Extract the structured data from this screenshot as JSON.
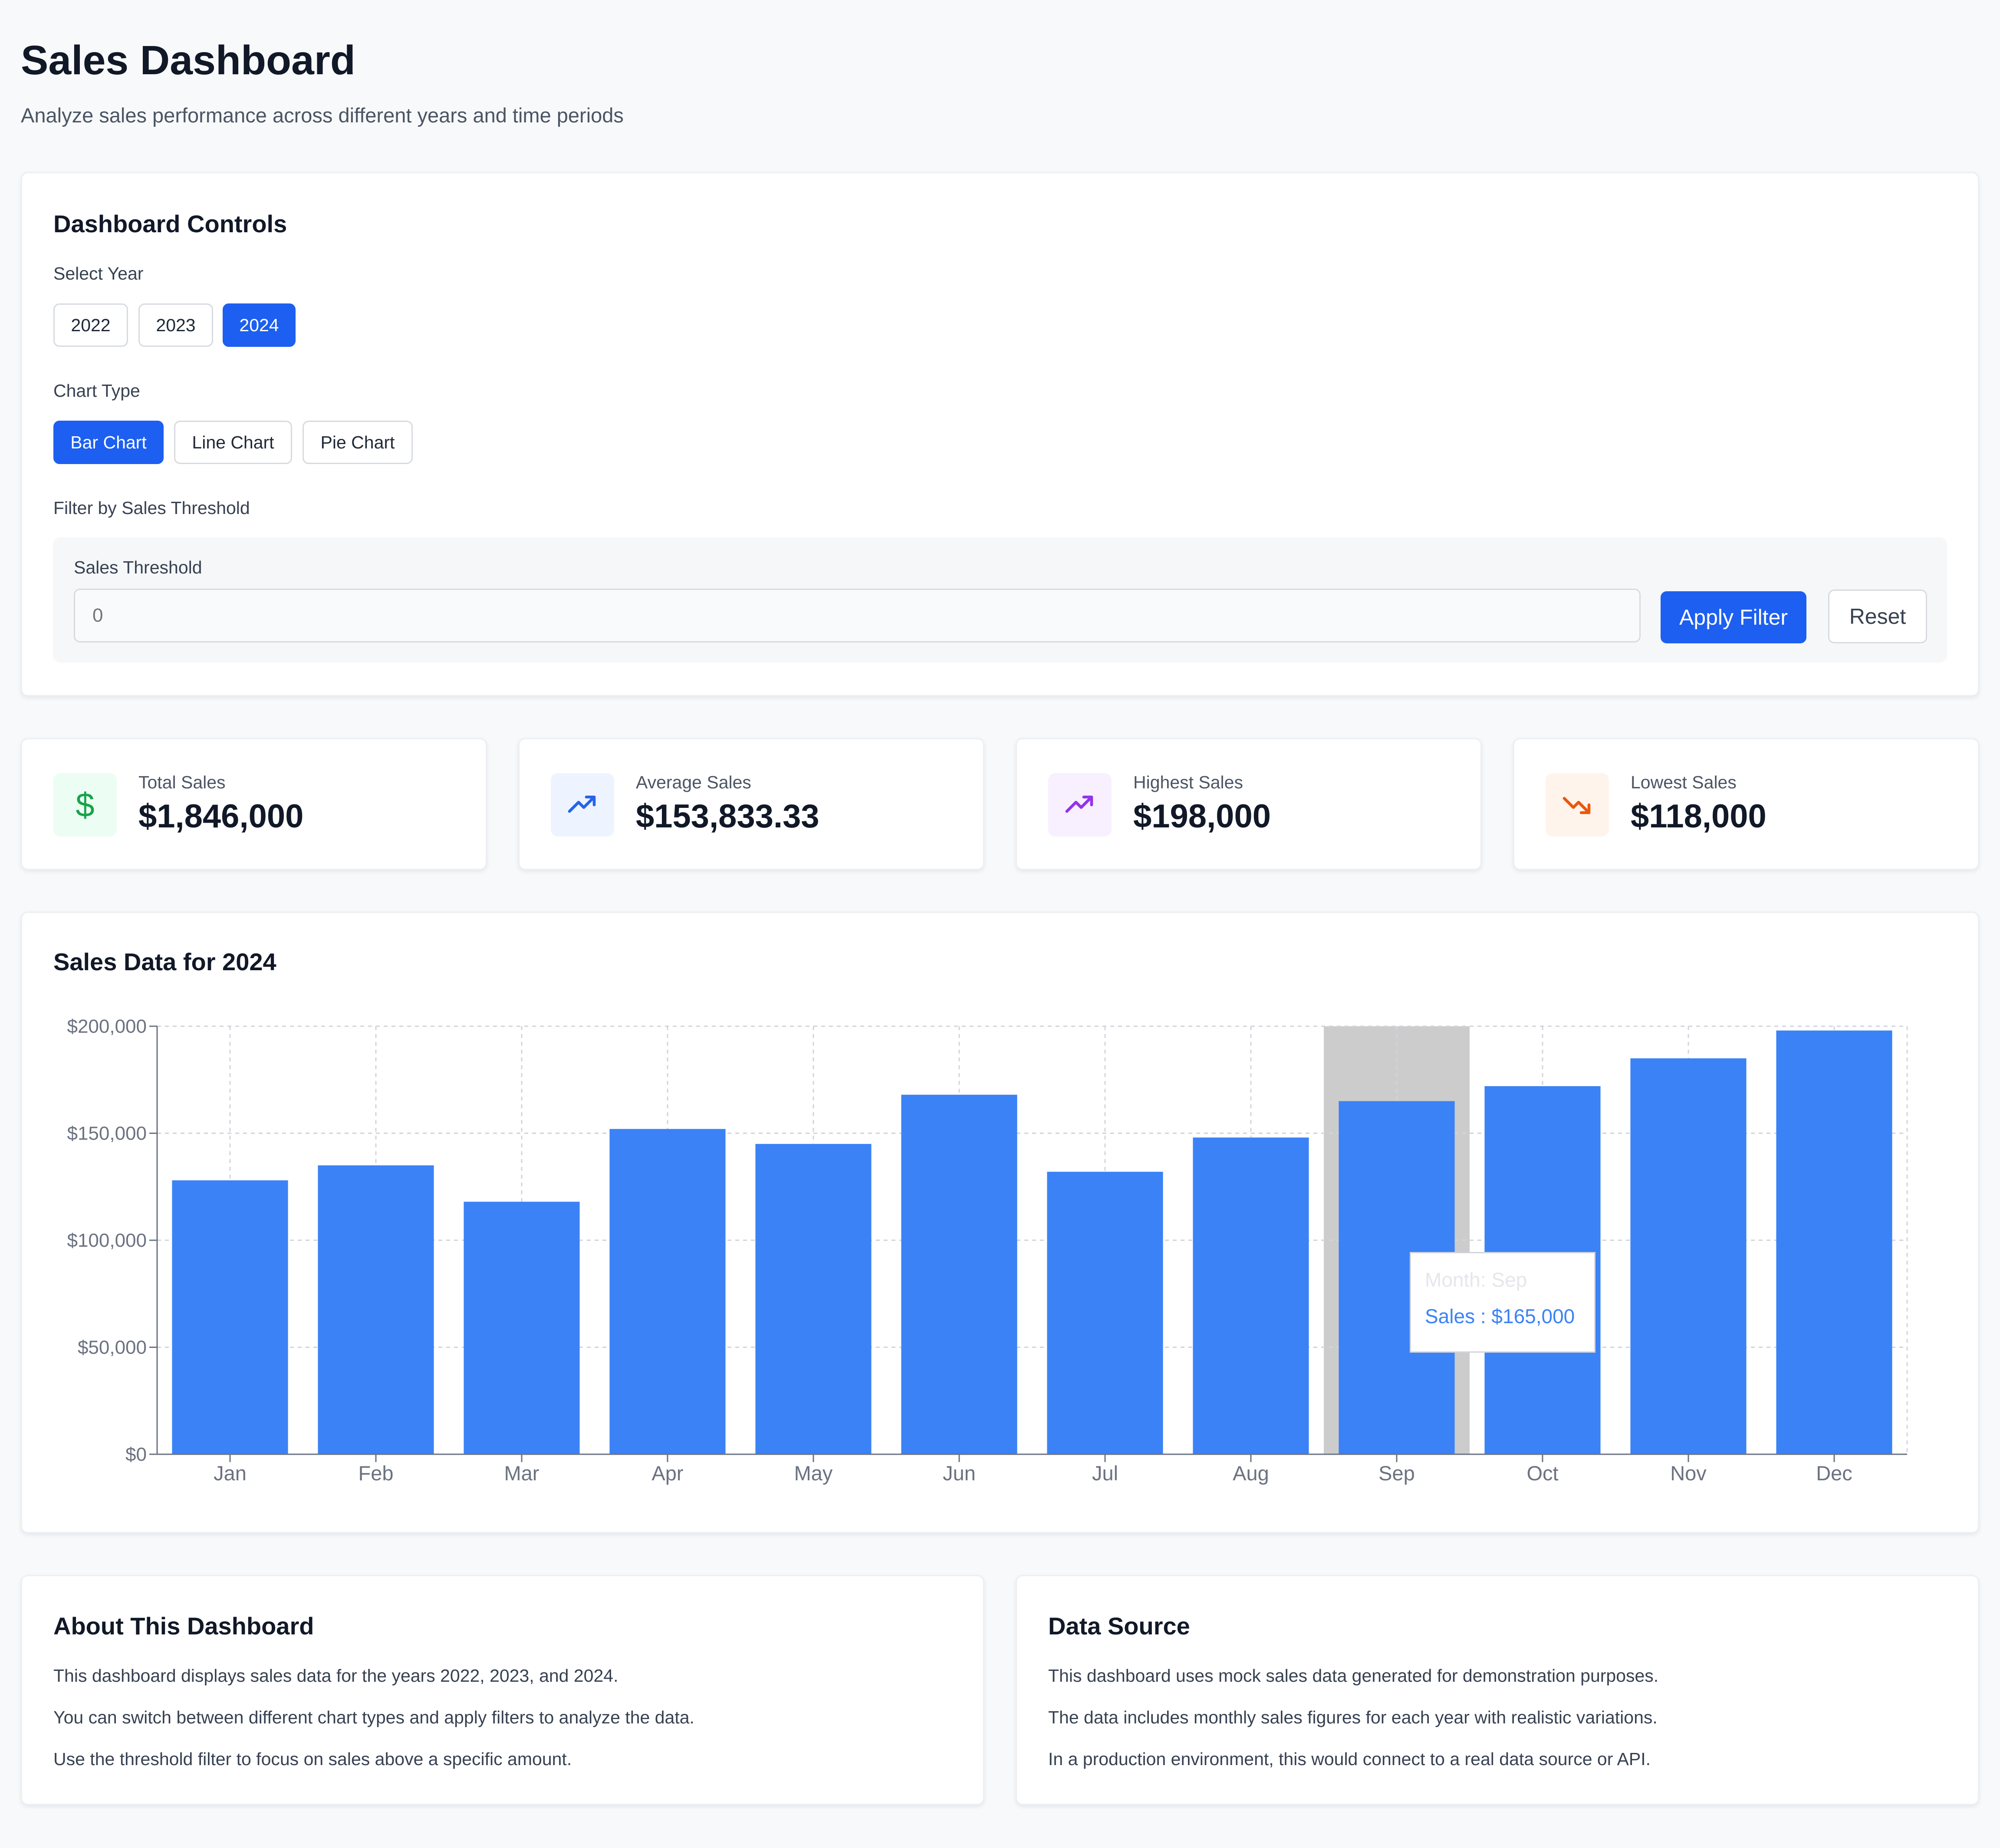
{
  "header": {
    "title": "Sales Dashboard",
    "subtitle": "Analyze sales performance across different years and time periods"
  },
  "controls": {
    "title": "Dashboard Controls",
    "year_label": "Select Year",
    "years": [
      "2022",
      "2023",
      "2024"
    ],
    "selected_year": "2024",
    "chart_type_label": "Chart Type",
    "chart_types": [
      "Bar Chart",
      "Line Chart",
      "Pie Chart"
    ],
    "selected_chart_type": "Bar Chart",
    "filter_label": "Filter by Sales Threshold",
    "threshold_label": "Sales Threshold",
    "threshold_placeholder": "0",
    "apply_label": "Apply Filter",
    "reset_label": "Reset"
  },
  "stats": [
    {
      "label": "Total Sales",
      "value": "$1,846,000",
      "icon": "dollar-icon",
      "color": "#16a34a",
      "bg": "#ecfdf3"
    },
    {
      "label": "Average Sales",
      "value": "$153,833.33",
      "icon": "trending-up-icon",
      "color": "#2563eb",
      "bg": "#eef4ff"
    },
    {
      "label": "Highest Sales",
      "value": "$198,000",
      "icon": "trending-up-icon",
      "color": "#9333ea",
      "bg": "#f8f0ff"
    },
    {
      "label": "Lowest Sales",
      "value": "$118,000",
      "icon": "trending-down-icon",
      "color": "#ea580c",
      "bg": "#fff4ec"
    }
  ],
  "chart_section": {
    "title": "Sales Data for 2024"
  },
  "chart_data": {
    "type": "bar",
    "categories": [
      "Jan",
      "Feb",
      "Mar",
      "Apr",
      "May",
      "Jun",
      "Jul",
      "Aug",
      "Sep",
      "Oct",
      "Nov",
      "Dec"
    ],
    "values": [
      128000,
      135000,
      118000,
      152000,
      145000,
      168000,
      132000,
      148000,
      165000,
      172000,
      185000,
      198000
    ],
    "ylim": [
      0,
      200000
    ],
    "yticks": [
      0,
      50000,
      100000,
      150000,
      200000
    ],
    "ytick_labels": [
      "$0",
      "$50,000",
      "$100,000",
      "$150,000",
      "$200,000"
    ],
    "grid": true,
    "bar_color": "#3b82f6",
    "highlight_index": 8,
    "tooltip": {
      "title": "Month: Sep",
      "value": "Sales : $165,000"
    }
  },
  "about": {
    "title": "About This Dashboard",
    "lines": [
      "This dashboard displays sales data for the years 2022, 2023, and 2024.",
      "You can switch between different chart types and apply filters to analyze the data.",
      "Use the threshold filter to focus on sales above a specific amount."
    ]
  },
  "data_source": {
    "title": "Data Source",
    "lines": [
      "This dashboard uses mock sales data generated for demonstration purposes.",
      "The data includes monthly sales figures for each year with realistic variations.",
      "In a production environment, this would connect to a real data source or API."
    ]
  }
}
